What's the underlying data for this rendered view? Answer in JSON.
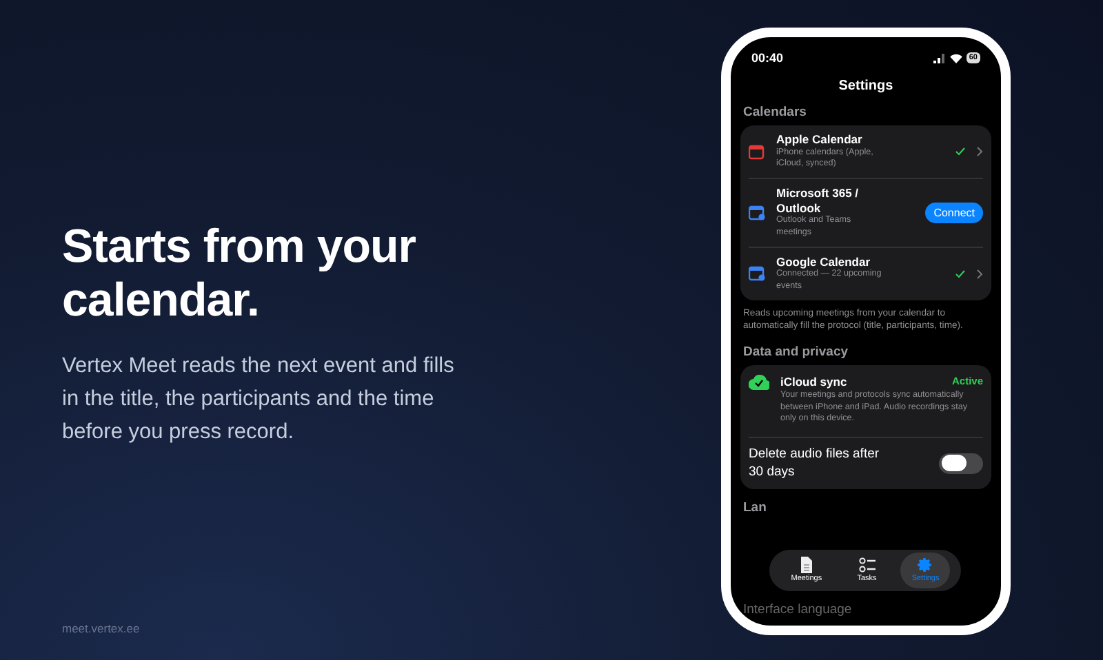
{
  "hero": {
    "headline": "Starts from your calendar.",
    "body": "Vertex Meet reads the next event and fills in the title, the participants and the time before you press record.",
    "footer_link": "meet.vertex.ee"
  },
  "phone": {
    "status_bar": {
      "time": "00:40",
      "battery": "60"
    },
    "title": "Settings",
    "sections": [
      {
        "header": "Calendars",
        "rows": [
          {
            "kind": "calendar",
            "title": "Apple Calendar",
            "subtitle": "iPhone calendars (Apple, iCloud, synced)",
            "connected": true
          },
          {
            "kind": "calendar",
            "title": "Microsoft 365 / Outlook",
            "subtitle": "Outlook and Teams meetings",
            "connected": false,
            "action": "Connect"
          },
          {
            "kind": "calendar",
            "title": "Google Calendar",
            "subtitle": "Connected — 22 upcoming events",
            "connected": true
          }
        ],
        "footnote": "Reads upcoming meetings from your calendar to automatically fill the protocol (title, participants, time)."
      },
      {
        "header": "Data and privacy",
        "rows": [
          {
            "kind": "sync",
            "title": "iCloud sync",
            "status": "Active",
            "subtitle": "Your meetings and protocols sync automatically between iPhone and iPad. Audio recordings stay only on this device."
          },
          {
            "kind": "toggle",
            "title": "Delete audio files after 30 days",
            "on": false
          }
        ]
      },
      {
        "header": "Lan",
        "rows": [
          {
            "kind": "plain",
            "title": "Interface language"
          }
        ]
      }
    ],
    "tabs": [
      {
        "label": "Meetings",
        "selected": false
      },
      {
        "label": "Tasks",
        "selected": false
      },
      {
        "label": "Settings",
        "selected": true
      }
    ]
  }
}
